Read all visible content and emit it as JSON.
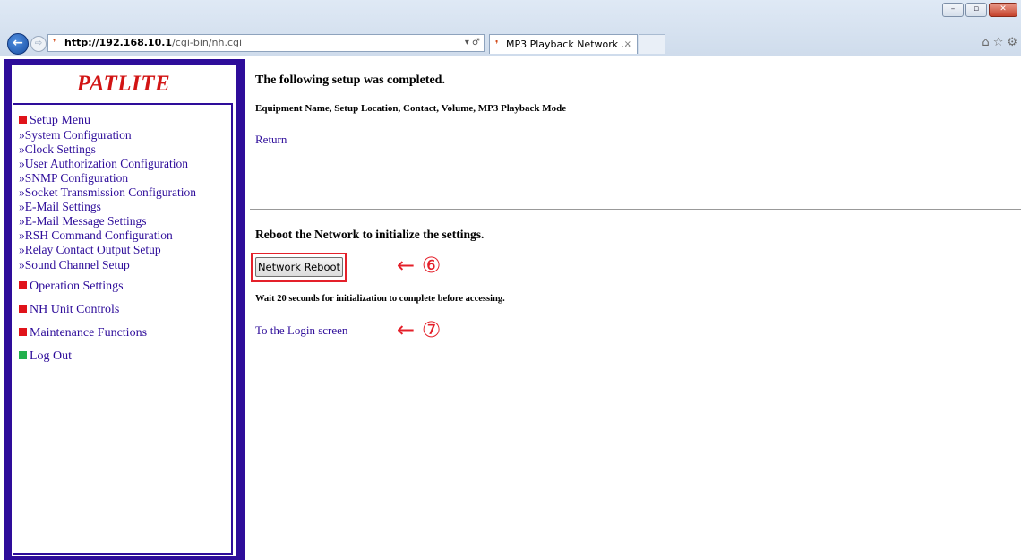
{
  "browser": {
    "window_controls": {
      "minimize": "–",
      "maximize": "▫",
      "close": "✕"
    },
    "back_glyph": "←",
    "forward_glyph": "⇨",
    "address": {
      "host": "http://192.168.10.1",
      "path": "/cgi-bin/nh.cgi",
      "controls": "▾ ♂"
    },
    "tab": {
      "title": "MP3 Playback Network ...",
      "close": "×"
    },
    "tools": {
      "home": "⌂",
      "favorites": "☆",
      "settings": "⚙"
    }
  },
  "nav": {
    "logo": "PATLITE",
    "setup_menu": "Setup Menu",
    "setup_items": [
      "»System Configuration",
      "»Clock Settings",
      "»User Authorization Configuration",
      "»SNMP Configuration",
      "»Socket Transmission Configuration",
      "»E-Mail Settings",
      "»E-Mail Message Settings",
      "»RSH Command Configuration",
      "»Relay Contact Output Setup",
      "»Sound Channel Setup"
    ],
    "operation_settings": "Operation Settings",
    "nh_unit_controls": "NH Unit Controls",
    "maintenance_functions": "Maintenance Functions",
    "log_out": "Log Out",
    "colors": {
      "frame": "#2e0d9a",
      "logo": "#d21414",
      "bullet_red": "#e0131a",
      "bullet_green": "#22b14c"
    }
  },
  "main": {
    "heading": "The following setup was completed.",
    "fields": "Equipment Name, Setup Location, Contact, Volume, MP3 Playback Mode",
    "return_link": "Return",
    "reboot_message": "Reboot the Network to initialize the settings.",
    "reboot_button": "Network Reboot",
    "wait_message": "Wait 20 seconds for initialization to complete before accessing.",
    "login_link": "To the Login screen"
  },
  "annotations": {
    "button_marker": "← ⑥",
    "login_marker": "← ⑦",
    "color": "#e4202a"
  }
}
